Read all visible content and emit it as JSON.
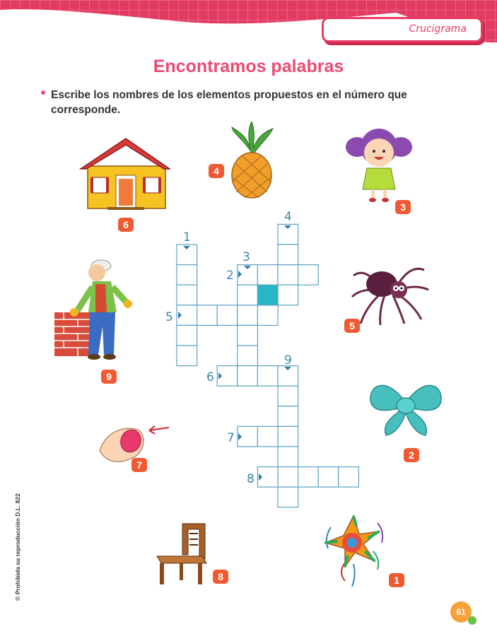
{
  "header": {
    "section_tab": "Crucigrama"
  },
  "page": {
    "title": "Encontramos palabras",
    "instruction": "Escribe los nombres de los elementos propuestos en el número que corresponde.",
    "copyright": "© Prohibida su reproducción D.L. 822",
    "page_number": "61"
  },
  "crossword": {
    "clue_numbers": {
      "n1": "1",
      "n2": "2",
      "n3": "3",
      "n4": "4",
      "n5": "5",
      "n6": "6",
      "n7": "7",
      "n8": "8",
      "n9": "9"
    }
  },
  "pictures": [
    {
      "icon": "pinata-icon",
      "number": "1"
    },
    {
      "icon": "bow-icon",
      "number": "2"
    },
    {
      "icon": "doll-icon",
      "number": "3"
    },
    {
      "icon": "pineapple-icon",
      "number": "4"
    },
    {
      "icon": "spider-icon",
      "number": "5"
    },
    {
      "icon": "house-icon",
      "number": "6"
    },
    {
      "icon": "fingernail-icon",
      "number": "7"
    },
    {
      "icon": "chair-icon",
      "number": "8"
    },
    {
      "icon": "bricklayer-icon",
      "number": "9"
    }
  ],
  "colors": {
    "accent": "#ec4a73",
    "grid": "#5ba3c4",
    "badge": "#f05a32",
    "black_cell": "#27b6c4"
  }
}
